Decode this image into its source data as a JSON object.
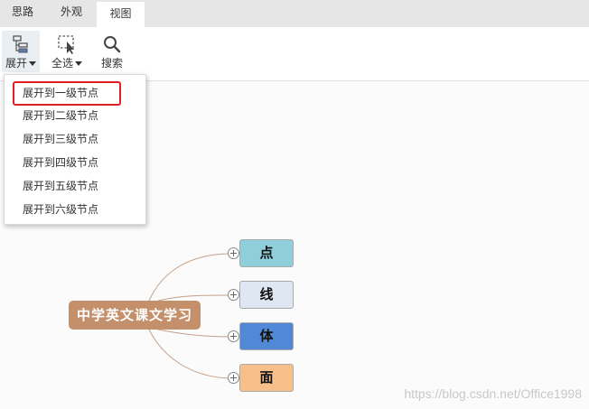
{
  "tabs": [
    {
      "label": "思路"
    },
    {
      "label": "外观"
    },
    {
      "label": "视图",
      "active": true
    }
  ],
  "toolbar": {
    "expand_label": "展开",
    "select_all_label": "全选",
    "search_label": "搜索"
  },
  "dropdown": {
    "items": [
      {
        "label": "展开到一级节点",
        "highlighted": true
      },
      {
        "label": "展开到二级节点"
      },
      {
        "label": "展开到三级节点"
      },
      {
        "label": "展开到四级节点"
      },
      {
        "label": "展开到五级节点"
      },
      {
        "label": "展开到六级节点"
      }
    ]
  },
  "mindmap": {
    "root": "中学英文课文学习",
    "children": [
      {
        "label": "点",
        "color": "#8fcfdc"
      },
      {
        "label": "线",
        "color": "#dfe7f2"
      },
      {
        "label": "体",
        "color": "#5189d6"
      },
      {
        "label": "面",
        "color": "#f7bf8a"
      }
    ],
    "root_color": "#c4906b",
    "link_color": "#c4a088"
  },
  "watermark": "https://blog.csdn.net/Office1998"
}
